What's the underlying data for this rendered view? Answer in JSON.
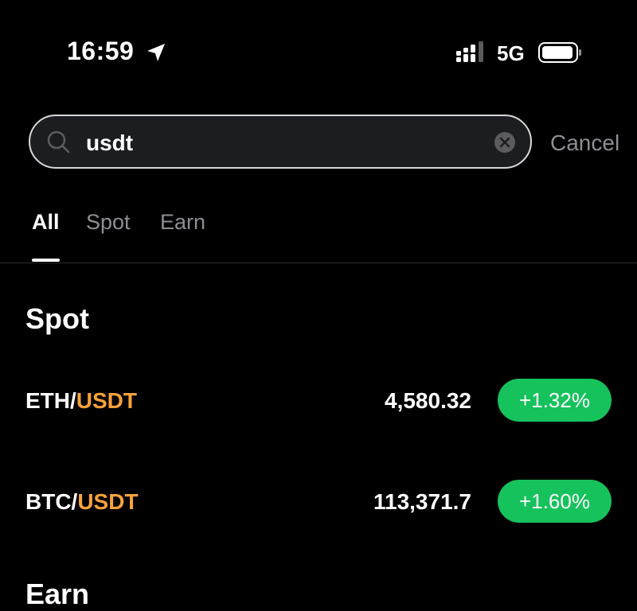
{
  "status_bar": {
    "time": "16:59",
    "network": "5G",
    "icons": [
      "location-arrow-icon",
      "signal-icon",
      "battery-icon"
    ]
  },
  "search": {
    "value": "usdt",
    "cancel_label": "Cancel",
    "icons": [
      "search-icon",
      "clear-icon"
    ]
  },
  "tabs": [
    {
      "label": "All",
      "active": true
    },
    {
      "label": "Spot",
      "active": false
    },
    {
      "label": "Earn",
      "active": false
    }
  ],
  "sections": {
    "spot": {
      "title": "Spot",
      "rows": [
        {
          "base": "ETH/",
          "quote": "USDT",
          "price": "4,580.32",
          "change": "+1.32%"
        },
        {
          "base": "BTC/",
          "quote": "USDT",
          "price": "113,371.7",
          "change": "+1.60%"
        }
      ]
    },
    "earn": {
      "title": "Earn"
    }
  },
  "colors": {
    "background": "#000000",
    "accent_quote": "#f7a23b",
    "positive": "#16c25c",
    "muted": "#8e8e93"
  }
}
